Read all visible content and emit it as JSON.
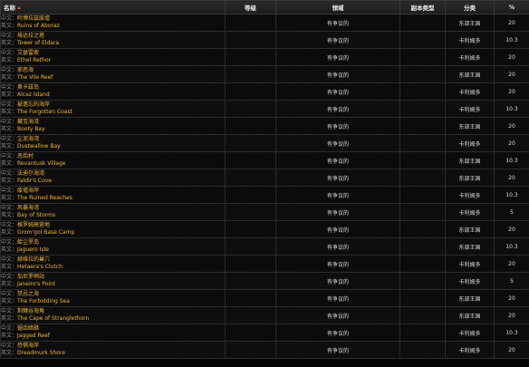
{
  "headers": {
    "name": "名称",
    "level": "等级",
    "territory": "领域",
    "instance_type": "副本类型",
    "category": "分类",
    "percent": "%"
  },
  "prefix_cn": "中文：",
  "prefix_en": "英文：",
  "rows": [
    {
      "cn": "阿博拉兹废墟",
      "en": "Ruins of Aboraz",
      "territory": "有争议的",
      "category": "东部王国",
      "pct": "20"
    },
    {
      "cn": "埃达拉之塔",
      "en": "Tower of Eldara",
      "territory": "有争议的",
      "category": "卡利姆多",
      "pct": "10.3"
    },
    {
      "cn": "艾瑟雷索",
      "en": "Ethel Rethor",
      "territory": "有争议的",
      "category": "卡利姆多",
      "pct": "20"
    },
    {
      "cn": "邪恶海",
      "en": "The Vile Reef",
      "territory": "有争议的",
      "category": "东部王国",
      "pct": "20"
    },
    {
      "cn": "奥卡兹岛",
      "en": "Alcaz Island",
      "territory": "有争议的",
      "category": "卡利姆多",
      "pct": "20"
    },
    {
      "cn": "被遗忘的海岸",
      "en": "The Forgotten Coast",
      "territory": "有争议的",
      "category": "卡利姆多",
      "pct": "10.3"
    },
    {
      "cn": "藏宝海湾",
      "en": "Booty Bay",
      "territory": "有争议的",
      "category": "东部王国",
      "pct": "20"
    },
    {
      "cn": "尘泥海湾",
      "en": "Dustwallow Bay",
      "territory": "有争议的",
      "category": "卡利姆多",
      "pct": "20"
    },
    {
      "cn": "恶齿村",
      "en": "Revantusk Village",
      "territory": "有争议的",
      "category": "东部王国",
      "pct": "10.3"
    },
    {
      "cn": "法迪尔海湾",
      "en": "Faldir's Cove",
      "territory": "有争议的",
      "category": "东部王国",
      "pct": "20"
    },
    {
      "cn": "废墟海岸",
      "en": "The Ruined Reaches",
      "territory": "有争议的",
      "category": "卡利姆多",
      "pct": "10.3"
    },
    {
      "cn": "风暴海湾",
      "en": "Bay of Storms",
      "territory": "有争议的",
      "category": "卡利姆多",
      "pct": "5"
    },
    {
      "cn": "格罗姆高营地",
      "en": "Grom'gol Base Camp",
      "territory": "有争议的",
      "category": "东部王国",
      "pct": "20"
    },
    {
      "cn": "蛤尘罗岛",
      "en": "Jaguero Isle",
      "territory": "有争议的",
      "category": "东部王国",
      "pct": "10.3"
    },
    {
      "cn": "赫维拉的巢穴",
      "en": "Hetaera's Clutch",
      "territory": "有争议的",
      "category": "卡利姆多",
      "pct": "20"
    },
    {
      "cn": "加尼罗哨站",
      "en": "Janeiro's Point",
      "territory": "有争议的",
      "category": "卡利姆多",
      "pct": "5"
    },
    {
      "cn": "禁忌之海",
      "en": "The Forbidding Sea",
      "territory": "有争议的",
      "category": "东部王国",
      "pct": "20"
    },
    {
      "cn": "荆棘谷海角",
      "en": "The Cape of Stranglethorn",
      "territory": "有争议的",
      "category": "东部王国",
      "pct": "20"
    },
    {
      "cn": "锯齿暗礁",
      "en": "Jagged Reef",
      "territory": "有争议的",
      "category": "卡利姆多",
      "pct": "10.3"
    },
    {
      "cn": "恐惧海岸",
      "en": "Dreadmurk Shore",
      "territory": "有争议的",
      "category": "卡利姆多",
      "pct": "20"
    }
  ]
}
